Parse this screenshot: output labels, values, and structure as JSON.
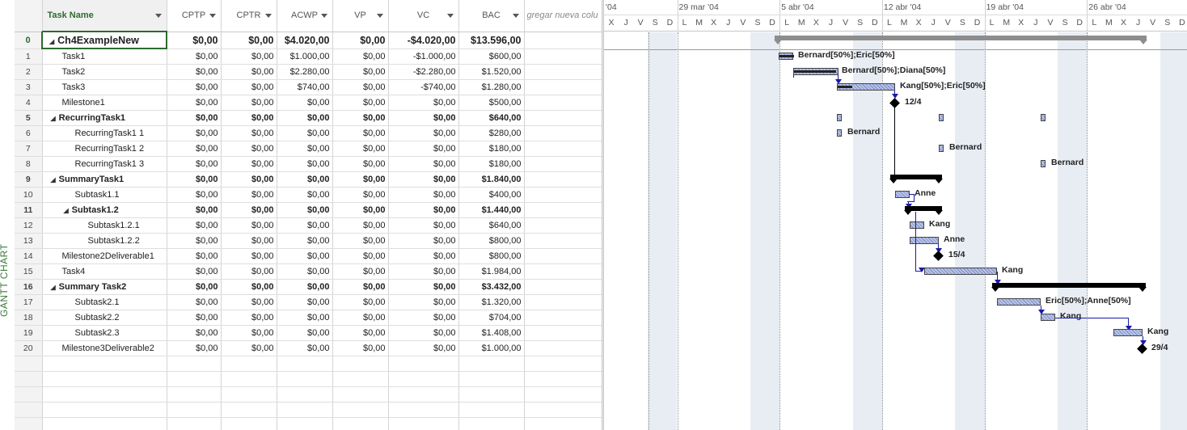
{
  "view_label": "GANTT CHART",
  "columns": {
    "task_name": "Task Name",
    "cptp": "CPTP",
    "cptr": "CPTR",
    "acwp": "ACWP",
    "vp": "VP",
    "vc": "VC",
    "bac": "BAC",
    "add_new": "gregar nueva colu"
  },
  "rows": [
    {
      "id": "0",
      "name": "Ch4ExampleNew",
      "cptp": "$0,00",
      "cptr": "$0,00",
      "acwp": "$4.020,00",
      "vp": "$0,00",
      "vc": "-$4.020,00",
      "bac": "$13.596,00"
    },
    {
      "id": "1",
      "name": "Task1",
      "cptp": "$0,00",
      "cptr": "$0,00",
      "acwp": "$1.000,00",
      "vp": "$0,00",
      "vc": "-$1.000,00",
      "bac": "$600,00"
    },
    {
      "id": "2",
      "name": "Task2",
      "cptp": "$0,00",
      "cptr": "$0,00",
      "acwp": "$2.280,00",
      "vp": "$0,00",
      "vc": "-$2.280,00",
      "bac": "$1.520,00"
    },
    {
      "id": "3",
      "name": "Task3",
      "cptp": "$0,00",
      "cptr": "$0,00",
      "acwp": "$740,00",
      "vp": "$0,00",
      "vc": "-$740,00",
      "bac": "$1.280,00"
    },
    {
      "id": "4",
      "name": "Milestone1",
      "cptp": "$0,00",
      "cptr": "$0,00",
      "acwp": "$0,00",
      "vp": "$0,00",
      "vc": "$0,00",
      "bac": "$500,00"
    },
    {
      "id": "5",
      "name": "RecurringTask1",
      "cptp": "$0,00",
      "cptr": "$0,00",
      "acwp": "$0,00",
      "vp": "$0,00",
      "vc": "$0,00",
      "bac": "$640,00"
    },
    {
      "id": "6",
      "name": "RecurringTask1 1",
      "cptp": "$0,00",
      "cptr": "$0,00",
      "acwp": "$0,00",
      "vp": "$0,00",
      "vc": "$0,00",
      "bac": "$280,00"
    },
    {
      "id": "7",
      "name": "RecurringTask1 2",
      "cptp": "$0,00",
      "cptr": "$0,00",
      "acwp": "$0,00",
      "vp": "$0,00",
      "vc": "$0,00",
      "bac": "$180,00"
    },
    {
      "id": "8",
      "name": "RecurringTask1 3",
      "cptp": "$0,00",
      "cptr": "$0,00",
      "acwp": "$0,00",
      "vp": "$0,00",
      "vc": "$0,00",
      "bac": "$180,00"
    },
    {
      "id": "9",
      "name": "SummaryTask1",
      "cptp": "$0,00",
      "cptr": "$0,00",
      "acwp": "$0,00",
      "vp": "$0,00",
      "vc": "$0,00",
      "bac": "$1.840,00"
    },
    {
      "id": "10",
      "name": "Subtask1.1",
      "cptp": "$0,00",
      "cptr": "$0,00",
      "acwp": "$0,00",
      "vp": "$0,00",
      "vc": "$0,00",
      "bac": "$400,00"
    },
    {
      "id": "11",
      "name": "Subtask1.2",
      "cptp": "$0,00",
      "cptr": "$0,00",
      "acwp": "$0,00",
      "vp": "$0,00",
      "vc": "$0,00",
      "bac": "$1.440,00"
    },
    {
      "id": "12",
      "name": "Subtask1.2.1",
      "cptp": "$0,00",
      "cptr": "$0,00",
      "acwp": "$0,00",
      "vp": "$0,00",
      "vc": "$0,00",
      "bac": "$640,00"
    },
    {
      "id": "13",
      "name": "Subtask1.2.2",
      "cptp": "$0,00",
      "cptr": "$0,00",
      "acwp": "$0,00",
      "vp": "$0,00",
      "vc": "$0,00",
      "bac": "$800,00"
    },
    {
      "id": "14",
      "name": "Milestone2Deliverable1",
      "cptp": "$0,00",
      "cptr": "$0,00",
      "acwp": "$0,00",
      "vp": "$0,00",
      "vc": "$0,00",
      "bac": "$800,00"
    },
    {
      "id": "15",
      "name": "Task4",
      "cptp": "$0,00",
      "cptr": "$0,00",
      "acwp": "$0,00",
      "vp": "$0,00",
      "vc": "$0,00",
      "bac": "$1.984,00"
    },
    {
      "id": "16",
      "name": "Summary Task2",
      "cptp": "$0,00",
      "cptr": "$0,00",
      "acwp": "$0,00",
      "vp": "$0,00",
      "vc": "$0,00",
      "bac": "$3.432,00"
    },
    {
      "id": "17",
      "name": "Subtask2.1",
      "cptp": "$0,00",
      "cptr": "$0,00",
      "acwp": "$0,00",
      "vp": "$0,00",
      "vc": "$0,00",
      "bac": "$1.320,00"
    },
    {
      "id": "18",
      "name": "Subtask2.2",
      "cptp": "$0,00",
      "cptr": "$0,00",
      "acwp": "$0,00",
      "vp": "$0,00",
      "vc": "$0,00",
      "bac": "$704,00"
    },
    {
      "id": "19",
      "name": "Subtask2.3",
      "cptp": "$0,00",
      "cptr": "$0,00",
      "acwp": "$0,00",
      "vp": "$0,00",
      "vc": "$0,00",
      "bac": "$1.408,00"
    },
    {
      "id": "20",
      "name": "Milestone3Deliverable2",
      "cptp": "$0,00",
      "cptr": "$0,00",
      "acwp": "$0,00",
      "vp": "$0,00",
      "vc": "$0,00",
      "bac": "$1.000,00"
    }
  ],
  "gantt": {
    "weeks": [
      "'04",
      "29 mar '04",
      "5 abr '04",
      "12 abr '04",
      "19 abr '04",
      "26 abr '04"
    ],
    "days": [
      "X",
      "J",
      "V",
      "S",
      "D",
      "L",
      "M",
      "X",
      "J",
      "V",
      "S",
      "D",
      "L",
      "M",
      "X",
      "J",
      "V",
      "S",
      "D",
      "L",
      "M",
      "X",
      "J",
      "V",
      "S",
      "D",
      "L",
      "M",
      "X",
      "J",
      "V",
      "S",
      "D",
      "L",
      "M",
      "X",
      "J",
      "V",
      "S",
      "D"
    ],
    "labels": {
      "task1": "Bernard[50%];Eric[50%]",
      "task2": "Bernard[50%];Diana[50%]",
      "task3": "Kang[50%];Eric[50%]",
      "ms1": "12/4",
      "rec1": "Bernard",
      "rec2": "Bernard",
      "rec3": "Bernard",
      "sub11": "Anne",
      "sub121": "Kang",
      "sub122": "Anne",
      "ms2": "15/4",
      "task4": "Kang",
      "sub21": "Eric[50%];Anne[50%]",
      "sub22": "Kang",
      "sub23": "Kang",
      "ms3": "29/4"
    }
  }
}
